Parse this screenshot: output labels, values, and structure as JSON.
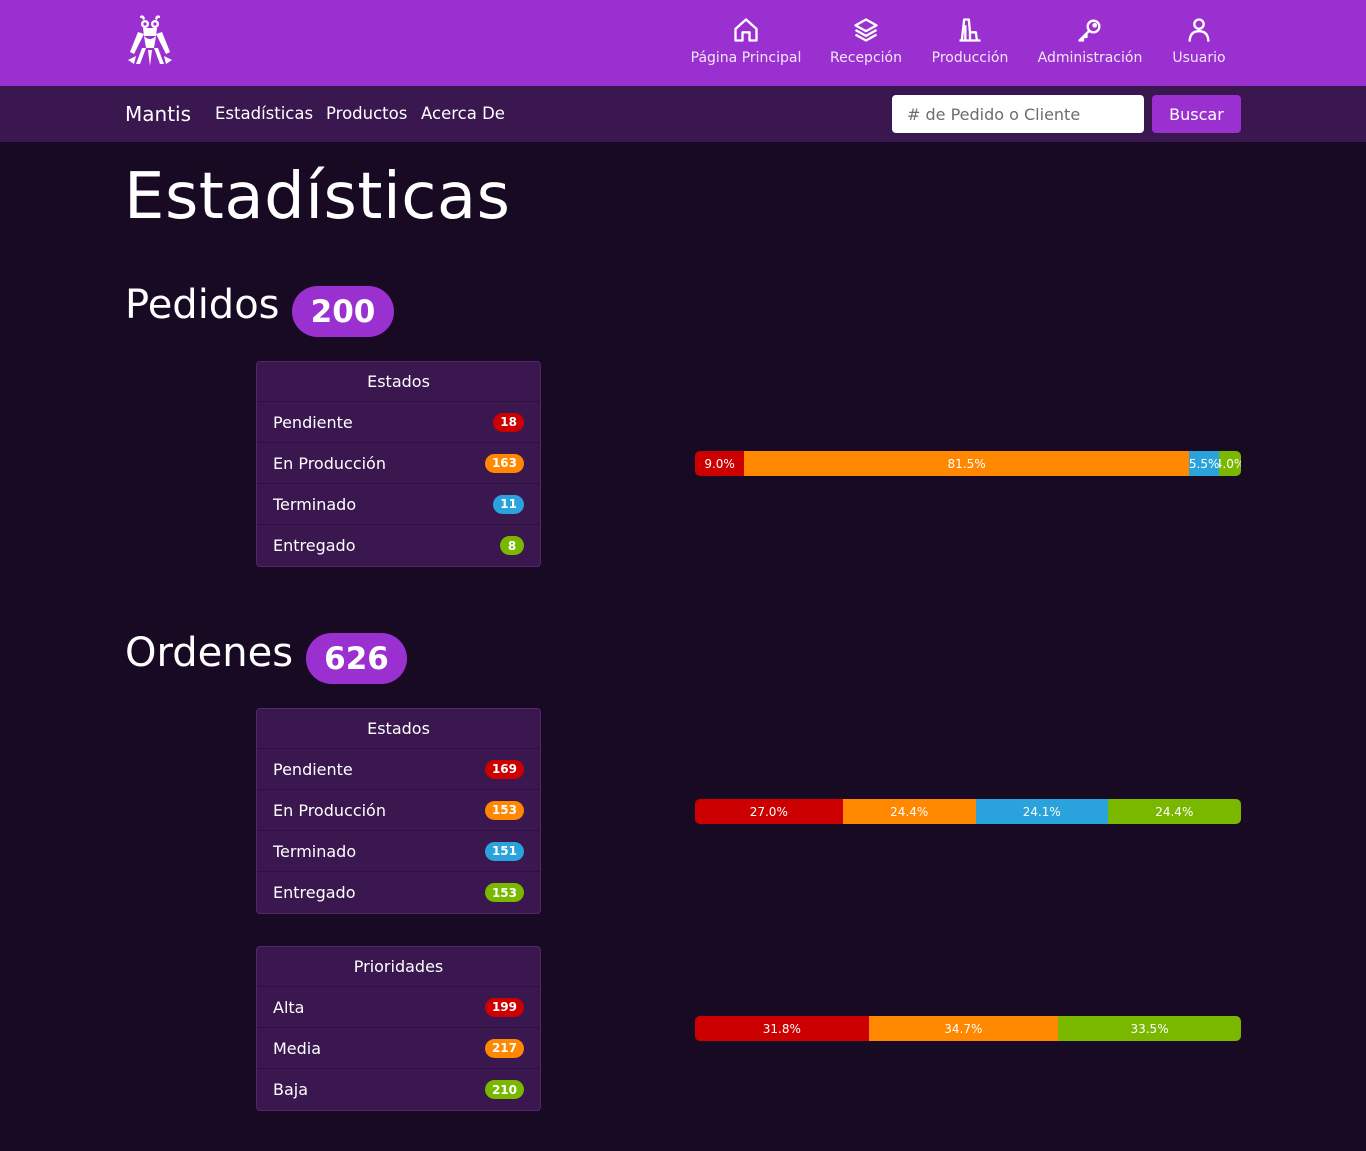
{
  "colors": {
    "red": "#cc0000",
    "orange": "#ff8800",
    "blue": "#2aa3dc",
    "green": "#7ab800",
    "purple": "#9b30d0"
  },
  "topnav": {
    "logo_icon": "mantis-logo-icon",
    "items": [
      {
        "label": "Página Principal",
        "icon": "home-icon"
      },
      {
        "label": "Recepción",
        "icon": "layers-icon"
      },
      {
        "label": "Producción",
        "icon": "factory-icon"
      },
      {
        "label": "Administración",
        "icon": "key-icon"
      },
      {
        "label": "Usuario",
        "icon": "user-icon"
      }
    ]
  },
  "subnav": {
    "brand": "Mantis",
    "links": [
      "Estadísticas",
      "Productos",
      "Acerca De"
    ],
    "search": {
      "placeholder": "# de Pedido o Cliente",
      "value": ""
    },
    "search_button": "Buscar"
  },
  "page_title": "Estadísticas",
  "pedidos": {
    "title": "Pedidos",
    "count": "200",
    "estados": {
      "header": "Estados",
      "rows": [
        {
          "name": "Pendiente",
          "count": "18"
        },
        {
          "name": "En Producción",
          "count": "163"
        },
        {
          "name": "Terminado",
          "count": "11"
        },
        {
          "name": "Entregado",
          "count": "8"
        }
      ],
      "bar": [
        "9.0%",
        "81.5%",
        "5.5%",
        "4.0%"
      ],
      "bar_values": [
        9.0,
        81.5,
        5.5,
        4.0
      ]
    }
  },
  "ordenes": {
    "title": "Ordenes",
    "count": "626",
    "estados": {
      "header": "Estados",
      "rows": [
        {
          "name": "Pendiente",
          "count": "169"
        },
        {
          "name": "En Producción",
          "count": "153"
        },
        {
          "name": "Terminado",
          "count": "151"
        },
        {
          "name": "Entregado",
          "count": "153"
        }
      ],
      "bar": [
        "27.0%",
        "24.4%",
        "24.1%",
        "24.4%"
      ],
      "bar_values": [
        27.0,
        24.4,
        24.1,
        24.4
      ]
    },
    "prioridades": {
      "header": "Prioridades",
      "rows": [
        {
          "name": "Alta",
          "count": "199"
        },
        {
          "name": "Media",
          "count": "217"
        },
        {
          "name": "Baja",
          "count": "210"
        }
      ],
      "bar": [
        "31.8%",
        "34.7%",
        "33.5%"
      ],
      "bar_values": [
        31.8,
        34.7,
        33.5
      ]
    }
  }
}
